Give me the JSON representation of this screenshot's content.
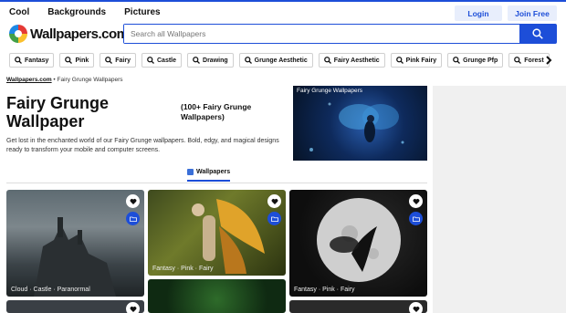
{
  "nav": {
    "items": [
      "Cool",
      "Backgrounds",
      "Pictures"
    ]
  },
  "auth": {
    "login": "Login",
    "join": "Join Free"
  },
  "logo": {
    "text": "Wallpapers.com"
  },
  "search": {
    "placeholder": "Search all Wallpapers",
    "icon": "search-icon"
  },
  "tags": [
    "Fantasy",
    "Pink",
    "Fairy",
    "Castle",
    "Drawing",
    "Grunge Aesthetic",
    "Fairy Aesthetic",
    "Pink Fairy",
    "Grunge Pfp",
    "Forest"
  ],
  "breadcrumb": {
    "home": "Wallpapers.com",
    "separator": "•",
    "current": "Fairy Grunge Wallpapers"
  },
  "page": {
    "title": "Fairy Grunge Wallpaper",
    "subtitle": "(100+ Fairy Grunge Wallpapers)",
    "description": "Get lost in the enchanted world of our Fairy Grunge wallpapers. Bold, edgy, and magical designs ready to transform your mobile and computer screens.",
    "hero_title": "Fairy Grunge Wallpapers"
  },
  "tabs": {
    "wallpapers": "Wallpapers"
  },
  "cards": [
    {
      "tags": "Cloud · Castle · Paranormal"
    },
    {
      "tags": "Fantasy · Pink · Fairy"
    },
    {
      "tags": "Fantasy · Pink · Fairy"
    }
  ],
  "colors": {
    "accent": "#1d4ed8"
  }
}
